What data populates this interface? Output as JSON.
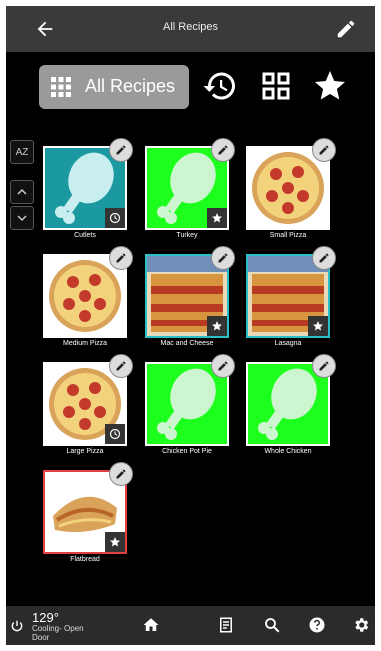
{
  "topbar": {
    "title": "All Recipes"
  },
  "tabs": {
    "all_label": "All Recipes"
  },
  "sidebar": {
    "az_label": "AZ"
  },
  "recipes": [
    {
      "name": "Cutlets",
      "badge": "clock"
    },
    {
      "name": "Turkey",
      "badge": "star"
    },
    {
      "name": "Small Pizza",
      "badge": ""
    },
    {
      "name": "Medium Pizza",
      "badge": ""
    },
    {
      "name": "Mac and Cheese",
      "badge": "star"
    },
    {
      "name": "Lasagna",
      "badge": "star"
    },
    {
      "name": "Large Pizza",
      "badge": "clock"
    },
    {
      "name": "Chicken Pot Pie",
      "badge": ""
    },
    {
      "name": "Whole Chicken",
      "badge": ""
    },
    {
      "name": "Flatbread",
      "badge": "star"
    }
  ],
  "bottombar": {
    "temperature": "129°",
    "status": "Cooling- Open Door"
  },
  "colors": {
    "teal": "#1a9aa0",
    "green": "#1dff1d",
    "topbar": "#3a3a3a",
    "selected_tab": "#9a9a9a"
  }
}
